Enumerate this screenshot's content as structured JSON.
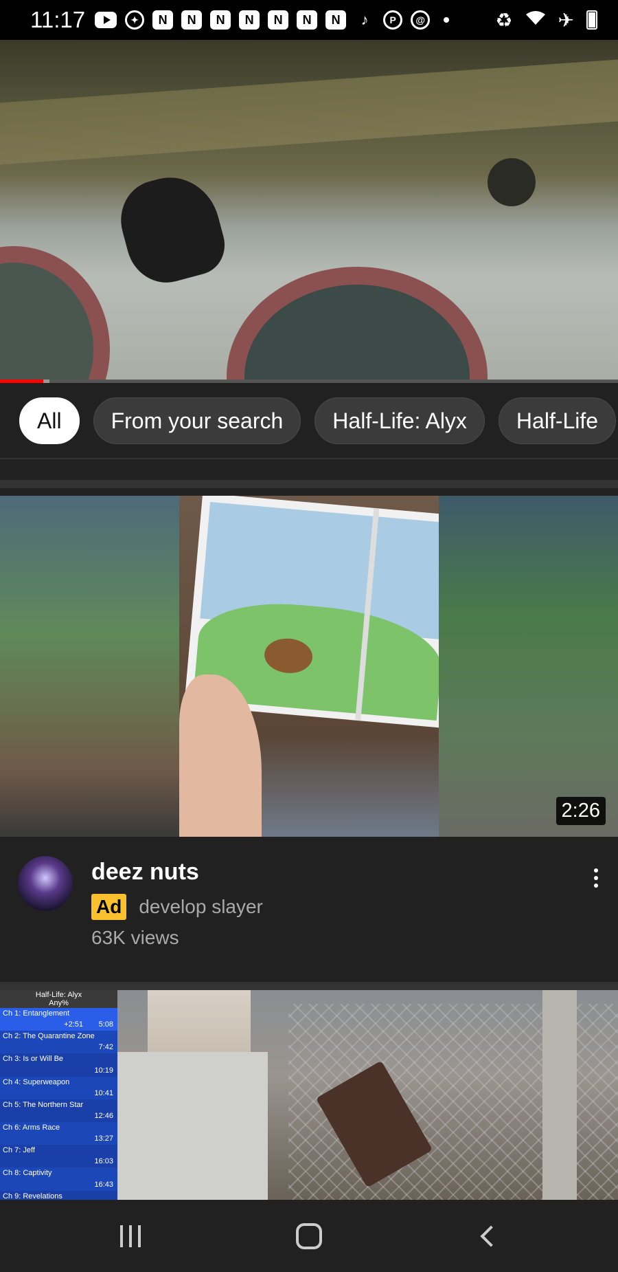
{
  "status_bar": {
    "time": "11:17",
    "notification_icons": [
      "youtube-icon",
      "messenger-icon",
      "n-icon",
      "n-icon",
      "n-icon",
      "n-icon",
      "n-icon",
      "n-icon",
      "n-icon",
      "tiktok-icon",
      "pinterest-icon",
      "threads-icon",
      "dot-icon"
    ],
    "system_icons": [
      "battery-saver-icon",
      "wifi-icon",
      "airplane-icon",
      "battery-icon"
    ]
  },
  "player": {
    "progress_fraction": 0.07,
    "buffer_fraction": 0.08
  },
  "chips": [
    {
      "label": "All",
      "active": true
    },
    {
      "label": "From your search",
      "active": false
    },
    {
      "label": "Half-Life: Alyx",
      "active": false
    },
    {
      "label": "Half-Life",
      "active": false
    }
  ],
  "ad_video": {
    "duration": "2:26",
    "title": "deez nuts",
    "ad_label": "Ad",
    "channel": "develop slayer",
    "views": "63K views"
  },
  "next_video": {
    "splits_title": "Half-Life: Alyx",
    "splits_category": "Any%",
    "splits": [
      {
        "name": "Ch 1: Entanglement",
        "delta": "+2:51",
        "time": "5:08"
      },
      {
        "name": "Ch 2: The Quarantine Zone",
        "delta": "",
        "time": "7:42"
      },
      {
        "name": "Ch 3: Is or Will Be",
        "delta": "",
        "time": "10:19"
      },
      {
        "name": "Ch 4: Superweapon",
        "delta": "",
        "time": "10:41"
      },
      {
        "name": "Ch 5: The Northern Star",
        "delta": "",
        "time": "12:46"
      },
      {
        "name": "Ch 6: Arms Race",
        "delta": "",
        "time": "13:27"
      },
      {
        "name": "Ch 7: Jeff",
        "delta": "",
        "time": "16:03"
      },
      {
        "name": "Ch 8: Captivity",
        "delta": "",
        "time": "16:43"
      },
      {
        "name": "Ch 9: Revelations",
        "delta": "",
        "time": ""
      }
    ]
  },
  "nav_bar": {
    "buttons": [
      "recents-icon",
      "home-icon",
      "back-icon"
    ]
  },
  "colors": {
    "background": "#212121",
    "progress": "#ff0000",
    "ad_badge": "#fbc02d",
    "chip_active_bg": "#ffffff",
    "chip_bg": "#3b3b3b"
  }
}
